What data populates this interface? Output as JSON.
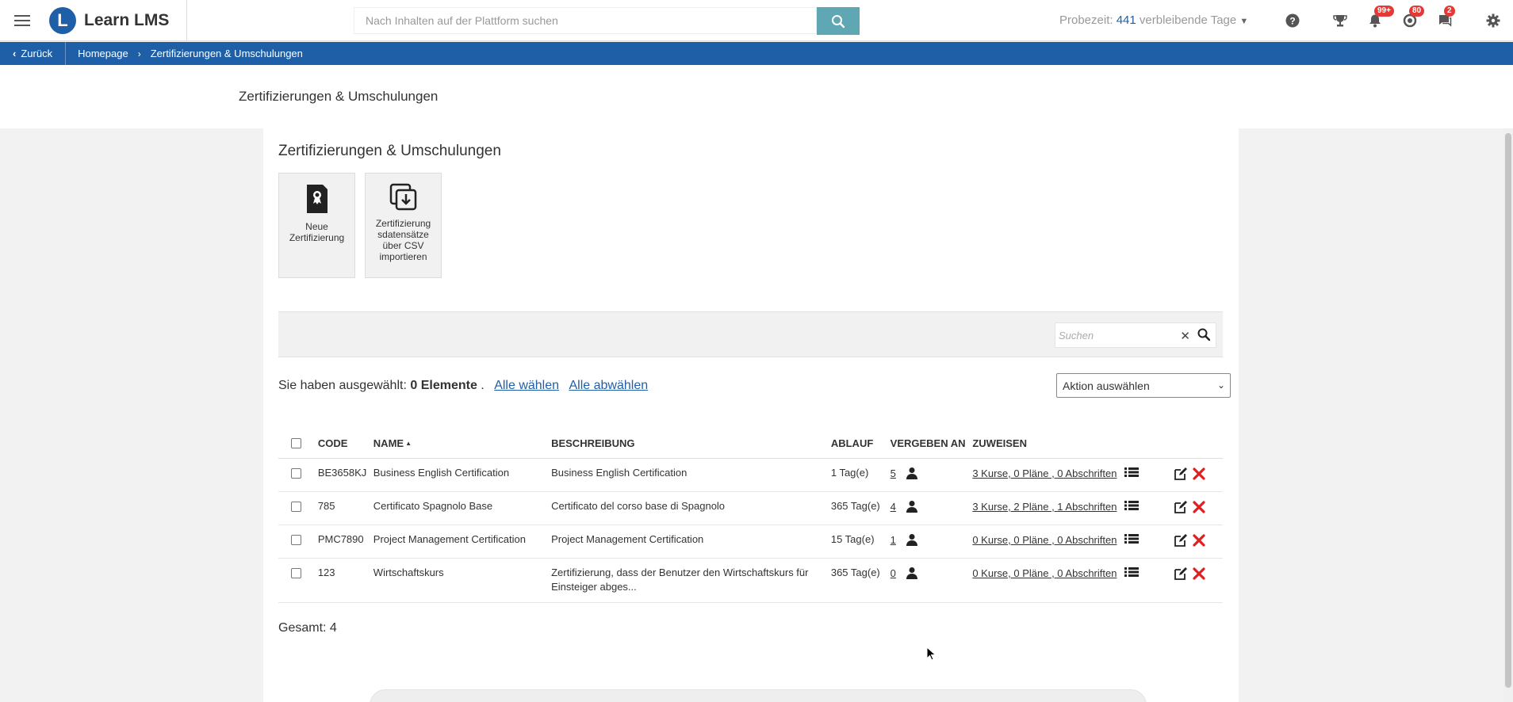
{
  "header": {
    "brand": "Learn LMS",
    "logo_letter": "L",
    "search_placeholder": "Nach Inhalten auf der Plattform suchen",
    "trial_label": "Probezeit:",
    "trial_days": "441",
    "trial_suffix": "verbleibende Tage",
    "notifications_badge": "99+",
    "messages_badge": "80",
    "chat_badge": "2"
  },
  "breadcrumb": {
    "back": "Zurück",
    "home": "Homepage",
    "current": "Zertifizierungen & Umschulungen"
  },
  "page": {
    "title": "Zertifizierungen & Umschulungen",
    "panel_title": "Zertifizierungen & Umschulungen"
  },
  "tiles": [
    {
      "label": "Neue Zertifizierung"
    },
    {
      "label": "Zertifizierung sdatensätze über CSV importieren"
    }
  ],
  "filter": {
    "search_placeholder": "Suchen"
  },
  "selection": {
    "prefix": "Sie haben ausgewählt:",
    "count": "0 Elemente",
    "dot": ".",
    "select_all": "Alle wählen",
    "deselect_all": "Alle abwählen",
    "action_select": "Aktion auswählen"
  },
  "table": {
    "columns": [
      "CODE",
      "NAME",
      "BESCHREIBUNG",
      "ABLAUF",
      "VERGEBEN AN",
      "ZUWEISEN"
    ],
    "sort_indicator": "▲",
    "rows": [
      {
        "code": "BE3658KJ",
        "name": "Business English Certification",
        "description": "Business English Certification",
        "expiry": "1 Tag(e)",
        "assigned": "5",
        "assign": "3 Kurse, 0 Pläne , 0 Abschriften"
      },
      {
        "code": "785",
        "name": "Certificato Spagnolo Base",
        "description": "Certificato del corso base di Spagnolo",
        "expiry": "365 Tag(e)",
        "assigned": "4",
        "assign": "3 Kurse, 2 Pläne , 1 Abschriften"
      },
      {
        "code": "PMC7890",
        "name": "Project Management Certification",
        "description": "Project Management Certification",
        "expiry": "15 Tag(e)",
        "assigned": "1",
        "assign": "0 Kurse, 0 Pläne , 0 Abschriften"
      },
      {
        "code": "123",
        "name": "Wirtschaftskurs",
        "description": "Zertifizierung, dass der Benutzer den Wirtschaftskurs für Einsteiger abges...",
        "expiry": "365 Tag(e)",
        "assigned": "0",
        "assign": "0 Kurse, 0 Pläne , 0 Abschriften"
      }
    ]
  },
  "footer": {
    "total": "Gesamt: 4"
  },
  "colors": {
    "brand_blue": "#1f5fa8",
    "search_button": "#5fa7b3",
    "badge_red": "#e53935",
    "delete_red": "#e02020"
  }
}
